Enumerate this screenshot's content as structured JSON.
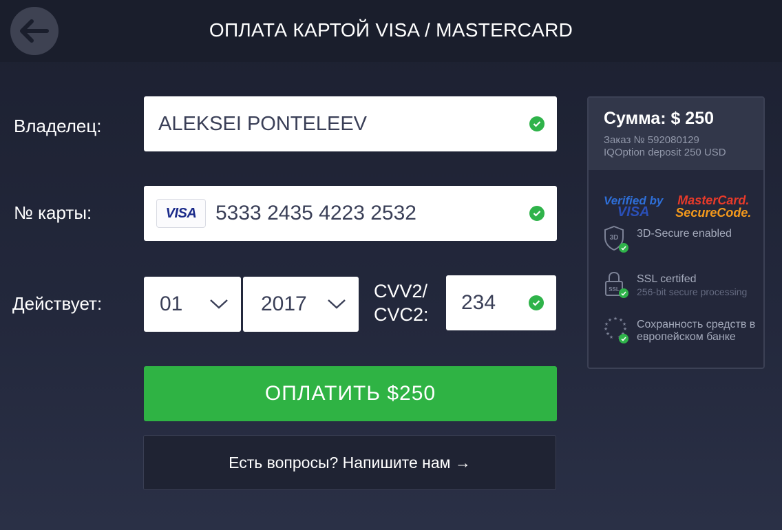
{
  "header": {
    "title": "ОПЛАТА КАРТОЙ VISA / MASTERCARD"
  },
  "form": {
    "owner_label": "Владелец:",
    "owner_value": "ALEKSEI PONTELEEV",
    "card_label": "№ карты:",
    "card_brand": "VISA",
    "card_value": "5333 2435 4223 2532",
    "expiry_label": "Действует:",
    "expiry_month": "01",
    "expiry_year": "2017",
    "cvv_label_line1": "CVV2/",
    "cvv_label_line2": "CVC2:",
    "cvv_value": "234",
    "pay_button": "ОПЛАТИТЬ $250",
    "help_button": "Есть вопросы? Напишите нам →"
  },
  "summary": {
    "sum": "Сумма: $ 250",
    "order_number": "Заказ № 592080129",
    "order_desc": "IQOption deposit 250 USD",
    "brand_vbv_line1": "Verified by",
    "brand_vbv_line2": "VISA",
    "brand_mc_line1": "MasterCard.",
    "brand_mc_line2": "SecureCode.",
    "features": [
      {
        "title": "3D-Secure enabled",
        "icon_label": "3D"
      },
      {
        "title": "SSL certifed",
        "subtitle": "256-bit secure processing",
        "icon_label": "SSL"
      },
      {
        "title": "Сохранность средств в европейском банке"
      }
    ]
  },
  "colors": {
    "accent_green": "#2fb344",
    "background": "#1c2030",
    "panel": "#23273a"
  }
}
